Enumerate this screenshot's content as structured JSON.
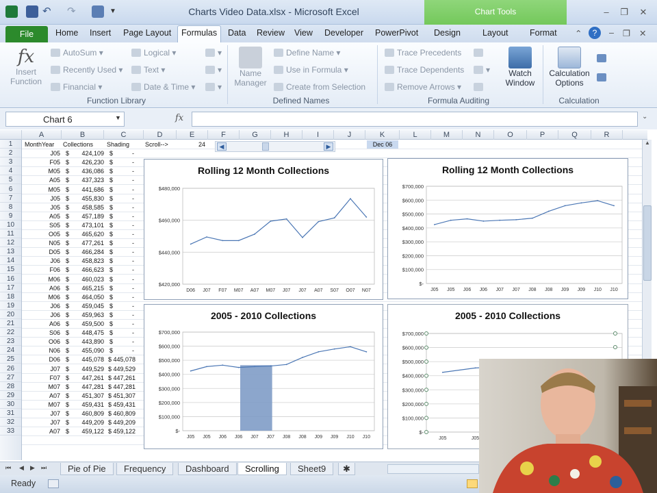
{
  "window": {
    "title": "Charts Video Data.xlsx  -  Microsoft Excel",
    "contextual_tab_group": "Chart Tools"
  },
  "tabs": [
    "File",
    "Home",
    "Insert",
    "Page Layout",
    "Formulas",
    "Data",
    "Review",
    "View",
    "Developer",
    "PowerPivot",
    "Design",
    "Layout",
    "Format"
  ],
  "ribbon": {
    "insert_function": [
      "Insert",
      "Function"
    ],
    "autosum": "AutoSum",
    "recently_used": "Recently Used",
    "financial": "Financial",
    "logical": "Logical",
    "text": "Text",
    "date_time": "Date & Time",
    "function_library": "Function Library",
    "name_manager": [
      "Name",
      "Manager"
    ],
    "define_name": "Define Name",
    "use_in_formula": "Use in Formula",
    "create_from_selection": "Create from Selection",
    "defined_names": "Defined Names",
    "trace_precedents": "Trace Precedents",
    "trace_dependents": "Trace Dependents",
    "remove_arrows": "Remove Arrows",
    "watch_window": [
      "Watch",
      "Window"
    ],
    "formula_auditing": "Formula Auditing",
    "calculation_options": [
      "Calculation",
      "Options"
    ],
    "calculation": "Calculation"
  },
  "formula_bar": {
    "name_box": "Chart 6",
    "fx": "fx",
    "formula": ""
  },
  "columns": [
    "A",
    "B",
    "C",
    "D",
    "E",
    "F",
    "G",
    "H",
    "I",
    "J",
    "K",
    "L",
    "M",
    "N",
    "O",
    "P",
    "Q",
    "R"
  ],
  "rows": [
    "1",
    "2",
    "3",
    "4",
    "5",
    "6",
    "7",
    "8",
    "9",
    "10",
    "11",
    "12",
    "13",
    "14",
    "15",
    "16",
    "17",
    "18",
    "19",
    "20",
    "21",
    "22",
    "23",
    "24",
    "25",
    "26",
    "27",
    "28",
    "29",
    "30",
    "31",
    "32",
    "33"
  ],
  "header_row": {
    "a": "MonthYear",
    "b": "Collections",
    "c": "Shading",
    "d": "Scroll-->",
    "e": "24",
    "k": "Dec 06"
  },
  "data_rows": [
    {
      "m": "J05",
      "v": "424,109",
      "s": "-"
    },
    {
      "m": "F05",
      "v": "426,230",
      "s": "-"
    },
    {
      "m": "M05",
      "v": "436,086",
      "s": "-"
    },
    {
      "m": "A05",
      "v": "437,323",
      "s": "-"
    },
    {
      "m": "M05",
      "v": "441,686",
      "s": "-"
    },
    {
      "m": "J05",
      "v": "455,830",
      "s": "-"
    },
    {
      "m": "J05",
      "v": "458,585",
      "s": "-"
    },
    {
      "m": "A05",
      "v": "457,189",
      "s": "-"
    },
    {
      "m": "S05",
      "v": "473,101",
      "s": "-"
    },
    {
      "m": "O05",
      "v": "465,620",
      "s": "-"
    },
    {
      "m": "N05",
      "v": "477,261",
      "s": "-"
    },
    {
      "m": "D05",
      "v": "466,284",
      "s": "-"
    },
    {
      "m": "J06",
      "v": "458,823",
      "s": "-"
    },
    {
      "m": "F06",
      "v": "466,623",
      "s": "-"
    },
    {
      "m": "M06",
      "v": "460,023",
      "s": "-"
    },
    {
      "m": "A06",
      "v": "465,215",
      "s": "-"
    },
    {
      "m": "M06",
      "v": "464,050",
      "s": "-"
    },
    {
      "m": "J06",
      "v": "459,045",
      "s": "-"
    },
    {
      "m": "J06",
      "v": "459,963",
      "s": "-"
    },
    {
      "m": "A06",
      "v": "459,500",
      "s": "-"
    },
    {
      "m": "S06",
      "v": "448,475",
      "s": "-"
    },
    {
      "m": "O06",
      "v": "443,890",
      "s": "-"
    },
    {
      "m": "N06",
      "v": "455,090",
      "s": "-"
    },
    {
      "m": "D06",
      "v": "445,078",
      "s": "$ 445,078"
    },
    {
      "m": "J07",
      "v": "449,529",
      "s": "$ 449,529"
    },
    {
      "m": "F07",
      "v": "447,261",
      "s": "$ 447,261"
    },
    {
      "m": "M07",
      "v": "447,281",
      "s": "$ 447,281"
    },
    {
      "m": "A07",
      "v": "451,307",
      "s": "$ 451,307"
    },
    {
      "m": "M07",
      "v": "459,431",
      "s": "$ 459,431"
    },
    {
      "m": "J07",
      "v": "460,809",
      "s": "$ 460,809"
    },
    {
      "m": "J07",
      "v": "449,209",
      "s": "$ 449,209"
    },
    {
      "m": "A07",
      "v": "459,122",
      "s": "$ 459,122"
    }
  ],
  "sheet_tabs": [
    "Pie of Pie",
    "Frequency",
    "Dashboard",
    "Scrolling",
    "Sheet9"
  ],
  "active_sheet": "Scrolling",
  "status": "Ready",
  "chart_data": [
    {
      "type": "line",
      "title": "Rolling 12 Month Collections",
      "categories": [
        "D06",
        "J07",
        "F07",
        "M07",
        "A07",
        "M07",
        "J07",
        "J07",
        "A07",
        "S07",
        "O07",
        "N07"
      ],
      "values": [
        445078,
        449529,
        447261,
        447281,
        451307,
        459431,
        460809,
        449209,
        459122,
        461500,
        473500,
        462000
      ],
      "y_ticks": [
        "$480,000",
        "$460,000",
        "$440,000",
        "$420,000"
      ],
      "ylim": [
        420000,
        480000
      ]
    },
    {
      "type": "line",
      "title": "Rolling 12 Month Collections",
      "categories": [
        "J05",
        "J05",
        "J06",
        "J06",
        "J07",
        "J07",
        "J08",
        "J08",
        "J09",
        "J09",
        "J10",
        "J10"
      ],
      "values": [
        424109,
        455000,
        465215,
        449000,
        455000,
        459000,
        470000,
        520000,
        560000,
        580000,
        596000,
        560000
      ],
      "y_ticks": [
        "$700,000",
        "$600,000",
        "$500,000",
        "$400,000",
        "$300,000",
        "$200,000",
        "$100,000",
        "$-"
      ],
      "ylim": [
        0,
        700000
      ]
    },
    {
      "type": "line",
      "title": "2005 - 2010 Collections",
      "categories": [
        "J05",
        "J05",
        "J06",
        "J06",
        "J07",
        "J07",
        "J08",
        "J08",
        "J09",
        "J09",
        "J10",
        "J10"
      ],
      "values": [
        424109,
        455000,
        465215,
        449000,
        455000,
        459000,
        470000,
        520000,
        560000,
        580000,
        596000,
        560000
      ],
      "y_ticks": [
        "$700,000",
        "$600,000",
        "$500,000",
        "$400,000",
        "$300,000",
        "$200,000",
        "$100,000",
        "$-"
      ],
      "ylim": [
        0,
        700000
      ]
    },
    {
      "type": "line",
      "title": "2005 - 2010 Collections",
      "categories": [
        "J05",
        "J05",
        "J06",
        "J06",
        "J07",
        "J07"
      ],
      "values": [
        424109,
        455000,
        465215,
        449000,
        455000,
        459000
      ],
      "y_ticks": [
        "$700,000",
        "$600,000",
        "$500,000",
        "$400,000",
        "$300,000",
        "$200,000",
        "$100,000",
        "$-"
      ],
      "ylim": [
        0,
        700000
      ]
    }
  ]
}
